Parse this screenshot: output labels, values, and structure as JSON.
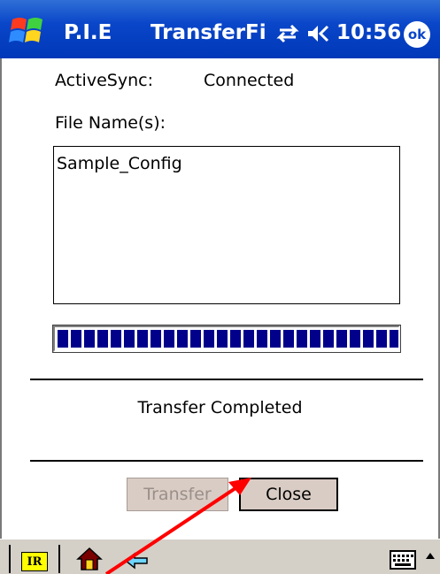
{
  "titlebar": {
    "app_name": "P.I.E",
    "window_title": "TransferFi",
    "clock": "10:56",
    "ok_label": "ok",
    "icons": [
      "windows-flag-icon",
      "sync-icon",
      "volume-icon"
    ]
  },
  "activesync": {
    "label": "ActiveSync:",
    "value": "Connected"
  },
  "files": {
    "label": "File Name(s):",
    "items": [
      "Sample_Config"
    ]
  },
  "progress": {
    "percent": 100
  },
  "status": "Transfer Completed",
  "buttons": {
    "transfer": "Transfer",
    "close": "Close"
  },
  "cmdbar": {
    "ir_label": "IR",
    "icons": [
      "ir-icon",
      "home-icon",
      "arrow-icon",
      "keyboard-icon",
      "input-arrow-icon"
    ]
  },
  "colors": {
    "titlebar": "#0a46c9",
    "progress_fill": "#00008b",
    "button_face": "#d9ccc4",
    "annotation_arrow": "#ff0000",
    "ir_background": "#ffff00"
  }
}
